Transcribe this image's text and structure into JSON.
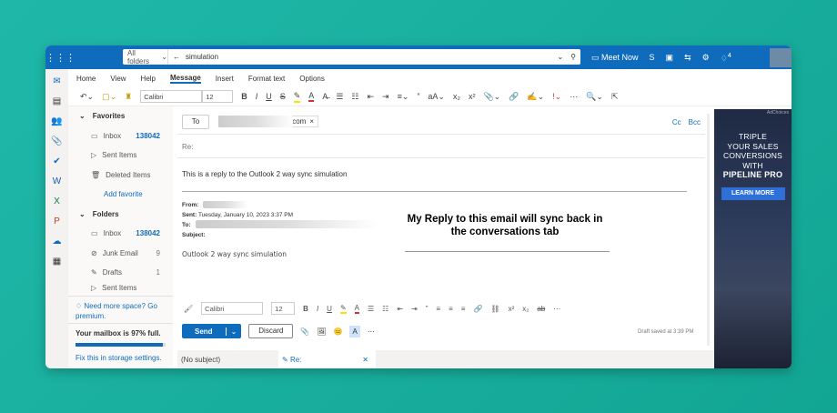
{
  "topbar": {
    "scope": "All folders",
    "search": "simulation",
    "meet_now": "Meet Now",
    "notif_count": "4"
  },
  "ribbon": {
    "tabs": [
      "Home",
      "View",
      "Help",
      "Message",
      "Insert",
      "Format text",
      "Options"
    ],
    "active": "Message",
    "font": "Calibri",
    "size": "12"
  },
  "folders": {
    "favorites": "Favorites",
    "fav_items": [
      {
        "label": "Inbox",
        "count": "138042"
      },
      {
        "label": "Sent Items",
        "count": ""
      },
      {
        "label": "Deleted Items",
        "count": ""
      }
    ],
    "add_favorite": "Add favorite",
    "folders": "Folders",
    "items": [
      {
        "label": "Inbox",
        "count": "138042"
      },
      {
        "label": "Junk Email",
        "count": "9"
      },
      {
        "label": "Drafts",
        "count": "1"
      },
      {
        "label": "Sent Items",
        "count": ""
      }
    ],
    "promo": "Need more space? Go premium.",
    "quota": "Your mailbox is 97% full.",
    "quota_pct": 97,
    "fix": "Fix this in storage settings."
  },
  "compose": {
    "to_label": "To",
    "recipient_suffix": "l.com",
    "cc": "Cc",
    "bcc": "Bcc",
    "subject": "Re:",
    "body": "This is a reply to the Outlook 2 way sync simulation",
    "from_label": "From:",
    "sent_label": "Sent:",
    "sent_value": "Tuesday, January 10, 2023 3:37 PM",
    "to_meta": "To:",
    "subject_label": "Subject:",
    "quoted": "Outlook 2 way sync simulation",
    "callout": "My Reply to this email will sync back in the conversations tab",
    "font": "Calibri",
    "size": "12",
    "send": "Send",
    "discard": "Discard",
    "saved": "Draft saved at 3:39 PM"
  },
  "bottom_tabs": {
    "no_subject": "(No subject)",
    "re": "Re:"
  },
  "ad": {
    "adchoices": "AdChoices",
    "line1": "TRIPLE",
    "line2": "YOUR SALES",
    "line3": "CONVERSIONS",
    "line4": "WITH",
    "brand": "PIPELINE PRO",
    "cta": "LEARN MORE"
  }
}
